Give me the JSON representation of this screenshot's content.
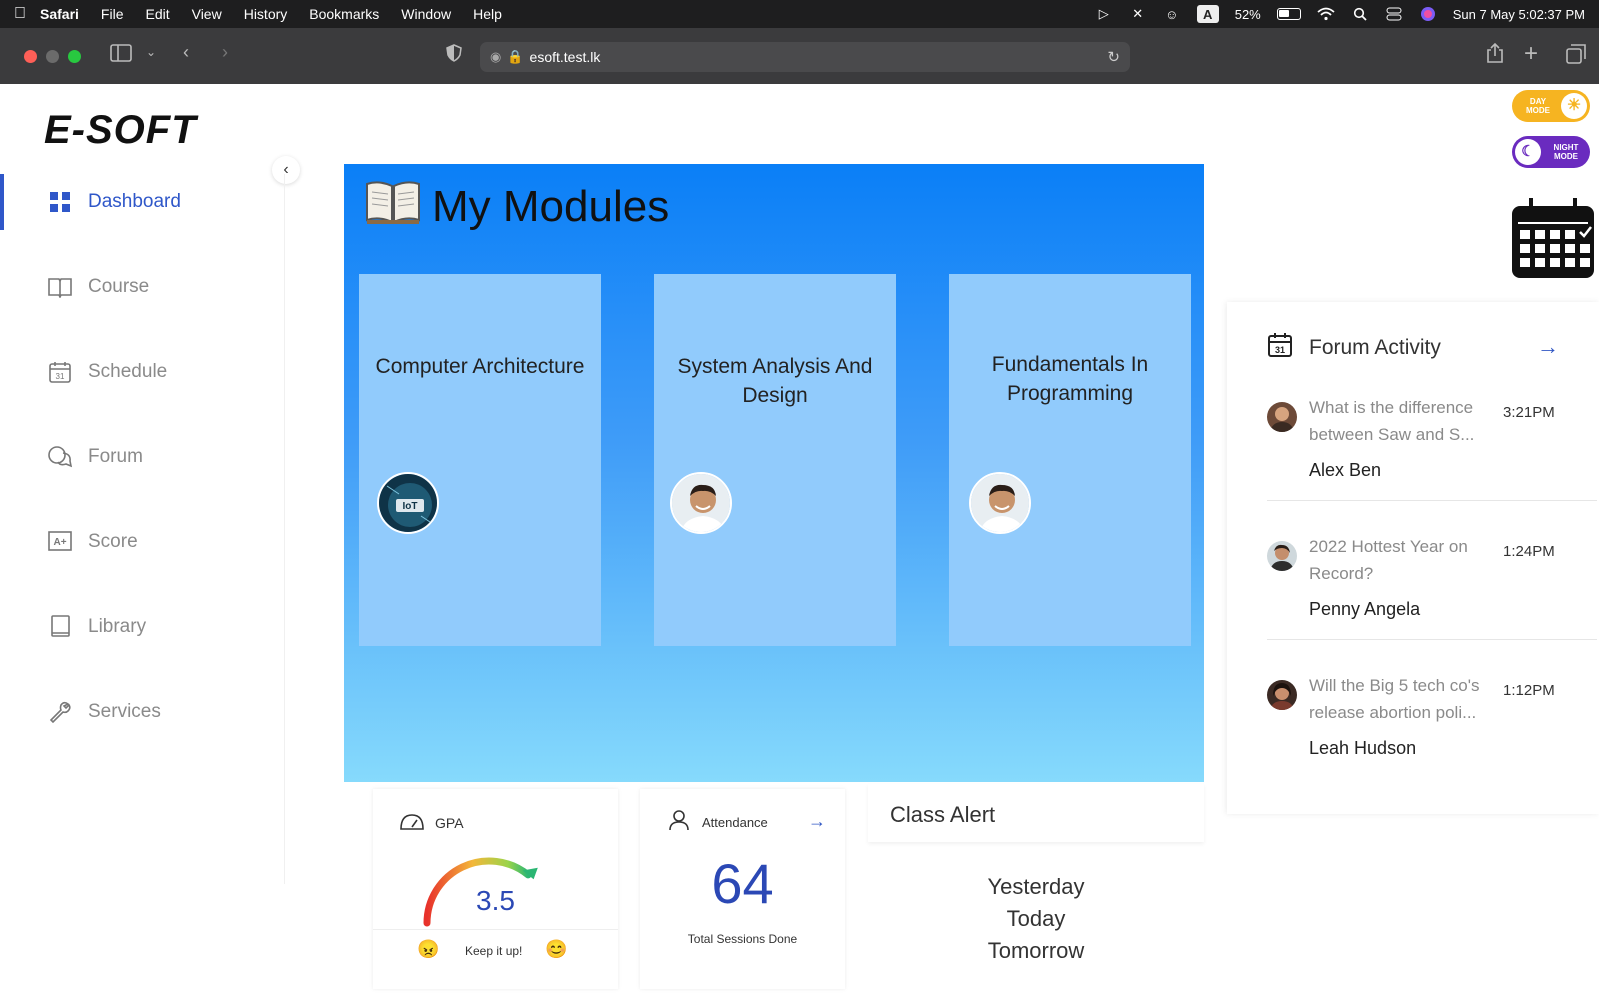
{
  "menubar": {
    "app": "Safari",
    "items": [
      "File",
      "Edit",
      "View",
      "History",
      "Bookmarks",
      "Window",
      "Help"
    ],
    "battery": "52%",
    "datetime": "Sun 7 May  5:02:37 PM",
    "input_source": "A"
  },
  "browser": {
    "url": "esoft.test.lk"
  },
  "app": {
    "logo": "E-SOFT",
    "day_mode": "DAY MODE",
    "night_mode": "NIGHT MODE"
  },
  "sidebar": {
    "items": [
      {
        "label": "Dashboard",
        "icon": "grid-icon",
        "active": true
      },
      {
        "label": "Course",
        "icon": "book-open-icon"
      },
      {
        "label": "Schedule",
        "icon": "calendar-icon"
      },
      {
        "label": "Forum",
        "icon": "chat-icon"
      },
      {
        "label": "Score",
        "icon": "grade-icon"
      },
      {
        "label": "Library",
        "icon": "book-icon"
      },
      {
        "label": "Services",
        "icon": "wrench-icon"
      }
    ]
  },
  "modules": {
    "title": "My Modules",
    "cards": [
      {
        "title": "Computer Architecture",
        "avatar": "iot-avatar"
      },
      {
        "title": "System Analysis And Design",
        "avatar": "lecturer-avatar"
      },
      {
        "title": "Fundamentals In Programming",
        "avatar": "lecturer-avatar"
      }
    ]
  },
  "gpa": {
    "label": "GPA",
    "value": "3.5",
    "gauge_fraction": 0.875,
    "message": "Keep it up!"
  },
  "attendance": {
    "label": "Attendance",
    "value": "64",
    "caption": "Total Sessions Done"
  },
  "class_alert": {
    "title": "Class Alert",
    "items": [
      "Yesterday",
      "Today",
      "Tomorrow"
    ]
  },
  "forum": {
    "title": "Forum Activity",
    "posts": [
      {
        "text": "What is the difference between Saw and S...",
        "time": "3:21PM",
        "author": "Alex Ben"
      },
      {
        "text": "2022 Hottest Year on Record?",
        "time": "1:24PM",
        "author": "Penny Angela"
      },
      {
        "text": "Will the Big 5 tech co's release abortion poli...",
        "time": "1:12PM",
        "author": "Leah Hudson"
      }
    ]
  },
  "colors": {
    "accent": "#2f57c9",
    "modules_top": "#0a7ff7",
    "modules_bottom": "#86dafc",
    "card": "#91cbfc"
  }
}
